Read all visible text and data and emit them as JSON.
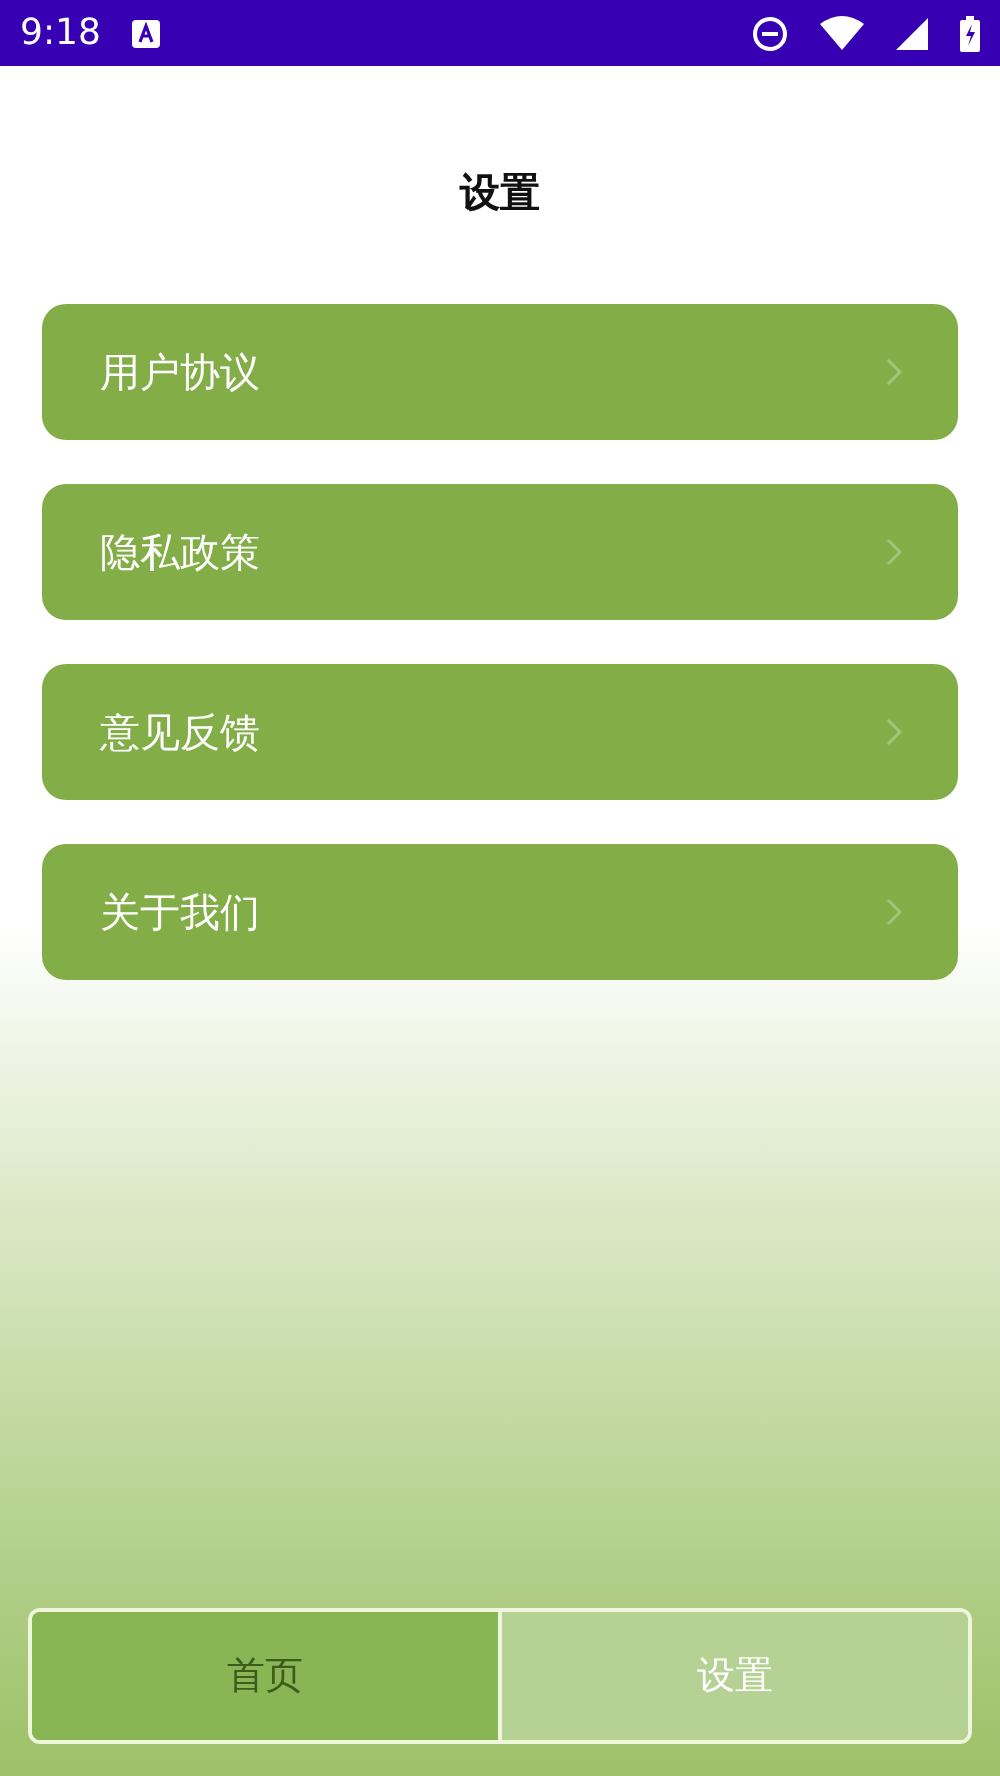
{
  "status_bar": {
    "time": "9:18"
  },
  "title": "设置",
  "menu_items": [
    {
      "label": "用户协议"
    },
    {
      "label": "隐私政策"
    },
    {
      "label": "意见反馈"
    },
    {
      "label": "关于我们"
    }
  ],
  "tabs": [
    {
      "label": "首页",
      "selected": false
    },
    {
      "label": "设置",
      "selected": true
    }
  ]
}
